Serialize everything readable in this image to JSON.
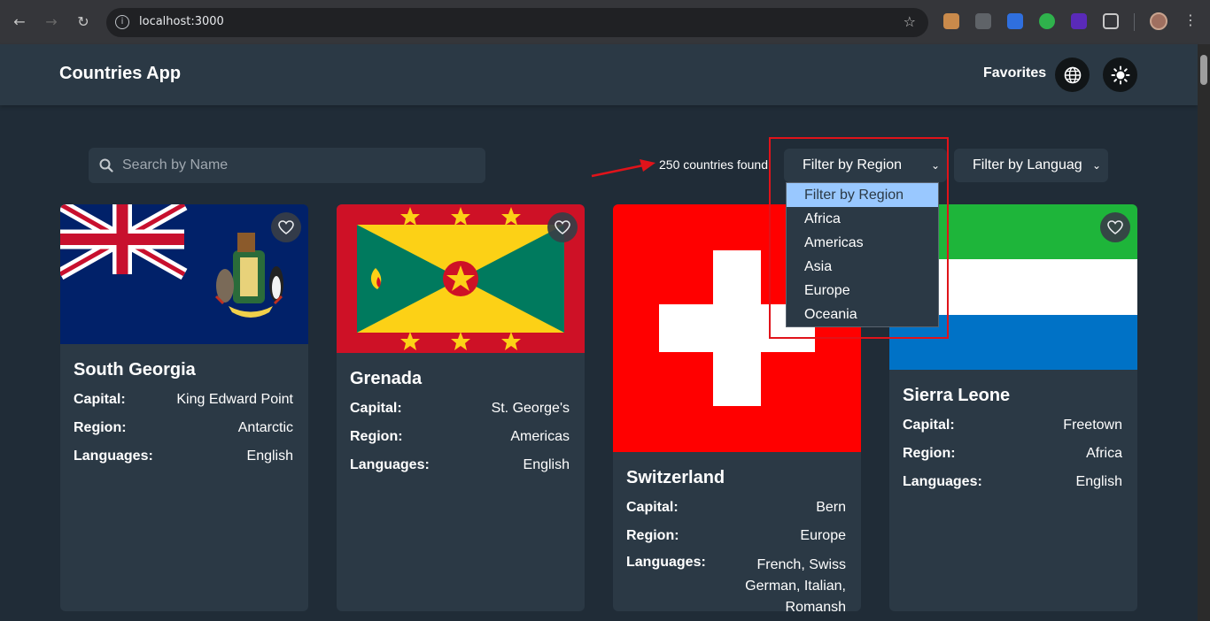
{
  "browser": {
    "url": "localhost:3000"
  },
  "header": {
    "title": "Countries App",
    "favorites_label": "Favorites"
  },
  "controls": {
    "search_placeholder": "Search by Name",
    "count_text": "250 countries found",
    "region_select": "Filter by Region",
    "language_select": "Filter by Languag",
    "region_options": [
      "Filter by Region",
      "Africa",
      "Americas",
      "Asia",
      "Europe",
      "Oceania"
    ]
  },
  "labels": {
    "capital": "Capital:",
    "region": "Region:",
    "languages": "Languages:"
  },
  "cards": [
    {
      "name": "South Georgia",
      "capital": "King Edward Point",
      "region": "Antarctic",
      "languages": "English"
    },
    {
      "name": "Grenada",
      "capital": "St. George's",
      "region": "Americas",
      "languages": "English"
    },
    {
      "name": "Switzerland",
      "capital": "Bern",
      "region": "Europe",
      "languages": "French, Swiss German, Italian, Romansh"
    },
    {
      "name": "Sierra Leone",
      "capital": "Freetown",
      "region": "Africa",
      "languages": "English"
    }
  ],
  "colors": {
    "background": "#202c37",
    "surface": "#2b3945",
    "annotation": "#e0131a"
  }
}
